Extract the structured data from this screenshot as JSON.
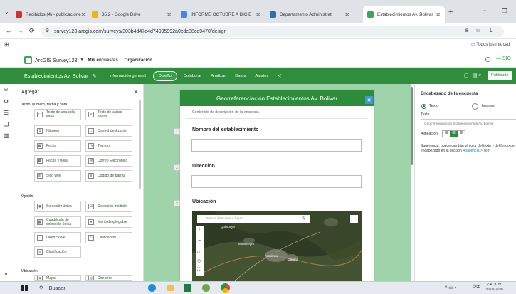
{
  "browser": {
    "tabs": [
      {
        "title": "Recibidos (4) - publicacione",
        "icon": "gmail-icon",
        "color": "#d93025"
      },
      {
        "title": "35.2 - Google Drive",
        "icon": "drive-icon",
        "color": "#f4b400"
      },
      {
        "title": "INFORME OCTUBRE A DICIE",
        "icon": "docs-icon",
        "color": "#4285f4"
      },
      {
        "title": "Departamento Administrati",
        "icon": "survey-icon",
        "color": "#2f6fb5"
      },
      {
        "title": "Establecimientos Av. Bolivar",
        "icon": "survey123-icon",
        "color": "#35a853"
      }
    ],
    "new_tab": "+",
    "url": "survey123.arcgis.com/surveys/303b4d47e4d74995992a0cde38cd9470/design",
    "bookmarks_label": "Todos los marcad",
    "profile_label": "SIG"
  },
  "app": {
    "name": "ArcGIS Survey123",
    "nav": [
      "Mis encuestas",
      "Organización"
    ]
  },
  "survey_bar": {
    "title": "Establecimientos Av. Bolivar",
    "tabs": [
      "Información general",
      "Diseño",
      "Colaborar",
      "Analizar",
      "Datos",
      "Ajustes"
    ],
    "active_tab": "Diseño",
    "publish": "Publicado"
  },
  "add_panel": {
    "title": "Agregar",
    "sections": [
      {
        "title": "Texto, número, fecha y hora",
        "items": [
          "Texto de una sola línea",
          "Texto de varias líneas",
          "Número",
          "Control deslizante",
          "Fecha",
          "Tiempo",
          "Fecha y hora",
          "Correo Electrónico",
          "Sitio web",
          "Código de barras"
        ]
      },
      {
        "title": "Opción",
        "items": [
          "Selección única",
          "Selección múltiple",
          "Cuadrícula de selección única",
          "Menú desplegable",
          "Likert Scale",
          "Calificación",
          "Clasificación"
        ]
      },
      {
        "title": "Ubicación",
        "items": [
          "Mapa",
          "Dirección"
        ]
      }
    ]
  },
  "form": {
    "header": "Georreferenciación Establecimientos Av. Bolivar",
    "description": "Contenido de descripción de la encuesta",
    "questions": [
      {
        "num": "1",
        "label": "Nombre del establecimiento"
      },
      {
        "num": "2",
        "label": "Dirección"
      },
      {
        "num": "3",
        "label": "Ubicación"
      }
    ],
    "map": {
      "search_placeholder": "Buscar dirección o lugar",
      "labels": [
        "Montenegro",
        "Armenia",
        "Calarcá",
        "Quimbaya"
      ]
    }
  },
  "right_panel": {
    "title": "Encabezado de la encuesta",
    "option_text": "Texto",
    "option_image": "Imagen",
    "text_label": "Texto",
    "text_value": "Georreferenciación Establecimientos Av. Bolivar",
    "align_label": "Alineación:",
    "hint": "Sugerencia: puede cambiar el color del texto y del fondo del encabezado en la sección",
    "hint_link": "Apariencia > Tem"
  },
  "taskbar": {
    "search": "Buscar",
    "lang": "ESP",
    "time": "2:40 p. m.",
    "date": "30/01/2026"
  }
}
